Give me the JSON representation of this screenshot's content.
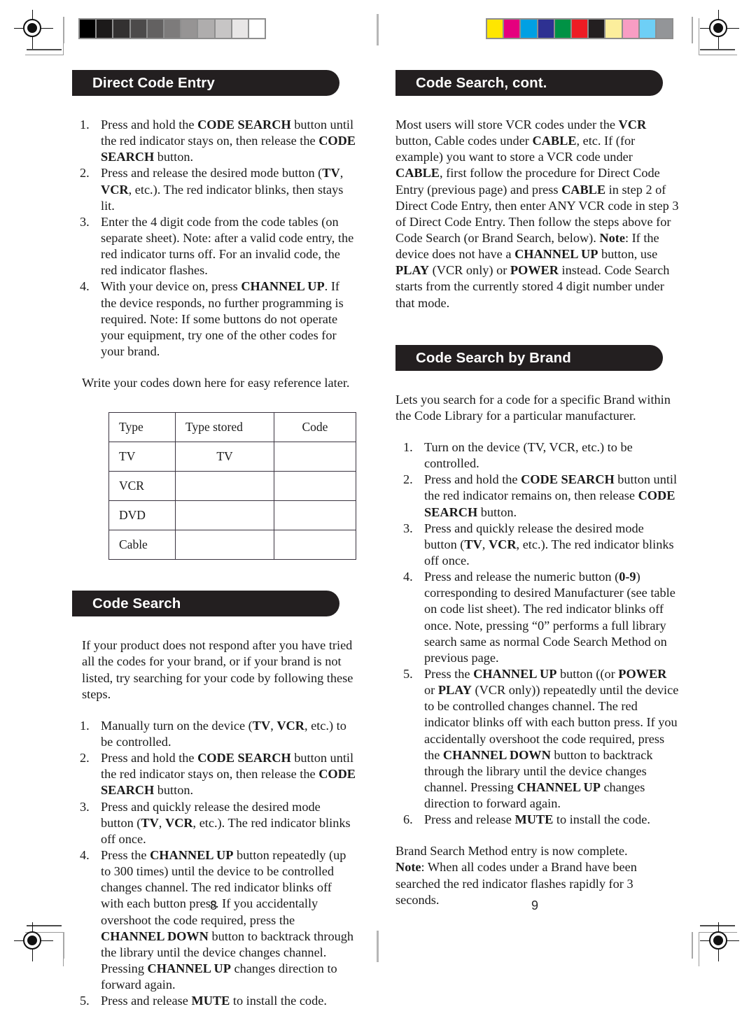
{
  "document": {
    "type": "universal-remote-instruction-manual-spread",
    "left_page_number": "8",
    "right_page_number": "9"
  },
  "print_marks": {
    "grayscale_strip": {
      "name": "grayscale-step-wedge",
      "patches": [
        "#000000",
        "#1c1a1a",
        "#333131",
        "#4c4a4a",
        "#636161",
        "#7d7b7b",
        "#969494",
        "#afadad",
        "#c7c5c5",
        "#e8e6e6",
        "#ffffff"
      ]
    },
    "color_strip": {
      "name": "process-color-bar",
      "patches": [
        "#ffe600",
        "#e5007e",
        "#00a0e3",
        "#2e3192",
        "#009245",
        "#ed1c24",
        "#231f20",
        "#fcee9c",
        "#f89dc3",
        "#6ecff6",
        "#939598"
      ]
    }
  },
  "left_page": {
    "section1": {
      "heading": "Direct Code Entry",
      "steps": [
        {
          "num": "1.",
          "parts": [
            {
              "t": "Press and hold the ",
              "b": false
            },
            {
              "t": "CODE SEARCH",
              "b": true
            },
            {
              "t": " button until the red indicator stays on, then release the ",
              "b": false
            },
            {
              "t": "CODE SEARCH",
              "b": true
            },
            {
              "t": " button.",
              "b": false
            }
          ]
        },
        {
          "num": "2.",
          "parts": [
            {
              "t": "Press and release the desired mode button (",
              "b": false
            },
            {
              "t": "TV",
              "b": true
            },
            {
              "t": ", ",
              "b": false
            },
            {
              "t": "VCR",
              "b": true
            },
            {
              "t": ", etc.). The red indicator blinks, then stays lit.",
              "b": false
            }
          ]
        },
        {
          "num": "3.",
          "parts": [
            {
              "t": "Enter the 4 digit code from the code tables (on separate sheet). Note: after a valid code entry, the red indicator turns off.  For an invalid code, the red indicator flashes.",
              "b": false
            }
          ]
        },
        {
          "num": "4.",
          "parts": [
            {
              "t": "With your device on, press ",
              "b": false
            },
            {
              "t": "CHANNEL UP",
              "b": true
            },
            {
              "t": ". If the device responds, no further programming is required. Note: If some buttons do not operate your equipment, try one of the other codes for your brand.",
              "b": false
            }
          ]
        }
      ],
      "note_line": "Write your codes down here for easy reference later.",
      "table": {
        "headers": [
          "Type",
          "Type stored",
          "Code"
        ],
        "rows": [
          [
            "TV",
            "TV",
            ""
          ],
          [
            "VCR",
            "",
            ""
          ],
          [
            "DVD",
            "",
            ""
          ],
          [
            "Cable",
            "",
            ""
          ]
        ]
      }
    },
    "section2": {
      "heading": "Code Search",
      "intro": "If your product does not respond after you have tried all the codes for your brand, or if your brand is not listed, try searching for your code by following these steps.",
      "steps": [
        {
          "num": "1.",
          "parts": [
            {
              "t": "Manually turn on the device (",
              "b": false
            },
            {
              "t": "TV",
              "b": true
            },
            {
              "t": ", ",
              "b": false
            },
            {
              "t": "VCR",
              "b": true
            },
            {
              "t": ", etc.) to be controlled.",
              "b": false
            }
          ]
        },
        {
          "num": "2.",
          "parts": [
            {
              "t": "Press and hold the ",
              "b": false
            },
            {
              "t": "CODE SEARCH",
              "b": true
            },
            {
              "t": " button until the red indicator stays on, then release the ",
              "b": false
            },
            {
              "t": "CODE SEARCH",
              "b": true
            },
            {
              "t": " button.",
              "b": false
            }
          ]
        },
        {
          "num": "3.",
          "parts": [
            {
              "t": "Press and quickly release the desired mode button (",
              "b": false
            },
            {
              "t": "TV",
              "b": true
            },
            {
              "t": ", ",
              "b": false
            },
            {
              "t": "VCR",
              "b": true
            },
            {
              "t": ", etc.). The red indicator blinks off once.",
              "b": false
            }
          ]
        },
        {
          "num": "4.",
          "parts": [
            {
              "t": "Press the ",
              "b": false
            },
            {
              "t": "CHANNEL UP",
              "b": true
            },
            {
              "t": " button repeatedly (up to 300 times) until the device to be controlled changes channel. The red indicator blinks off with each button press.  If you accidentally overshoot the code required, press the ",
              "b": false
            },
            {
              "t": "CHANNEL DOWN",
              "b": true
            },
            {
              "t": " button to backtrack through the library until the device changes channel. Pressing ",
              "b": false
            },
            {
              "t": "CHANNEL UP",
              "b": true
            },
            {
              "t": " changes direction to forward again.",
              "b": false
            }
          ]
        },
        {
          "num": "5.",
          "parts": [
            {
              "t": "Press and release ",
              "b": false
            },
            {
              "t": "MUTE",
              "b": true
            },
            {
              "t": " to install the code.",
              "b": false
            }
          ]
        }
      ]
    }
  },
  "right_page": {
    "section1": {
      "heading": "Code Search, cont.",
      "body_parts": [
        {
          "t": "Most users will store VCR codes under the ",
          "b": false
        },
        {
          "t": "VCR",
          "b": true
        },
        {
          "t": " button, Cable codes under ",
          "b": false
        },
        {
          "t": "CABLE",
          "b": true
        },
        {
          "t": ", etc. If (for example) you want to store a VCR code under ",
          "b": false
        },
        {
          "t": "CABLE",
          "b": true
        },
        {
          "t": ", first follow the procedure for Direct Code Entry (previous page) and press ",
          "b": false
        },
        {
          "t": "CABLE",
          "b": true
        },
        {
          "t": " in step 2 of Direct Code Entry, then enter ANY VCR code in step 3 of Direct Code Entry. Then follow the steps above for Code Search (or Brand Search, below). ",
          "b": false
        },
        {
          "t": "Note",
          "b": true
        },
        {
          "t": ":  If the device does not have a ",
          "b": false
        },
        {
          "t": "CHANNEL UP",
          "b": true
        },
        {
          "t": " button, use ",
          "b": false
        },
        {
          "t": "PLAY",
          "b": true
        },
        {
          "t": " (VCR only) or ",
          "b": false
        },
        {
          "t": "POWER",
          "b": true
        },
        {
          "t": " instead. Code Search starts from the currently stored 4 digit number under that mode.",
          "b": false
        }
      ]
    },
    "section2": {
      "heading": "Code Search by Brand",
      "intro": "Lets you search for a code for a specific Brand within the Code Library for a particular manufacturer.",
      "steps": [
        {
          "num": "1.",
          "parts": [
            {
              "t": "Turn on the device (TV, VCR, etc.) to be controlled.",
              "b": false
            }
          ]
        },
        {
          "num": "2.",
          "parts": [
            {
              "t": "Press and hold the ",
              "b": false
            },
            {
              "t": "CODE SEARCH",
              "b": true
            },
            {
              "t": " button until the red indicator remains on, then release ",
              "b": false
            },
            {
              "t": "CODE SEARCH",
              "b": true
            },
            {
              "t": " button.",
              "b": false
            }
          ]
        },
        {
          "num": "3.",
          "parts": [
            {
              "t": "Press and quickly release the desired mode button (",
              "b": false
            },
            {
              "t": "TV",
              "b": true
            },
            {
              "t": ", ",
              "b": false
            },
            {
              "t": "VCR",
              "b": true
            },
            {
              "t": ", etc.). The red indicator blinks off once.",
              "b": false
            }
          ]
        },
        {
          "num": "4.",
          "parts": [
            {
              "t": "Press and release the numeric button (",
              "b": false
            },
            {
              "t": "0-9",
              "b": true
            },
            {
              "t": ") corresponding to desired Manufacturer (see table on code list sheet).  The red indicator blinks off once. Note, pressing “0” performs a full library search same as normal Code Search Method on previous page.",
              "b": false
            }
          ]
        },
        {
          "num": "5.",
          "parts": [
            {
              "t": "Press the ",
              "b": false
            },
            {
              "t": "CHANNEL UP",
              "b": true
            },
            {
              "t": " button ((or ",
              "b": false
            },
            {
              "t": "POWER",
              "b": true
            },
            {
              "t": " or ",
              "b": false
            },
            {
              "t": "PLAY",
              "b": true
            },
            {
              "t": " (VCR only)) repeatedly until the device to be controlled changes channel. The red indicator blinks off with each button press. If you accidentally overshoot the code required, press the ",
              "b": false
            },
            {
              "t": "CHANNEL DOWN",
              "b": true
            },
            {
              "t": " button to backtrack through the library until the device changes channel. Pressing ",
              "b": false
            },
            {
              "t": "CHANNEL UP",
              "b": true
            },
            {
              "t": " changes direction to forward again.",
              "b": false
            }
          ]
        },
        {
          "num": "6.",
          "parts": [
            {
              "t": "Press and release ",
              "b": false
            },
            {
              "t": "MUTE",
              "b": true
            },
            {
              "t": " to install the code.",
              "b": false
            }
          ]
        }
      ],
      "closing_line": "Brand Search Method entry is now complete.",
      "closing_note_parts": [
        {
          "t": "Note",
          "b": true
        },
        {
          "t": ": When all codes under a Brand have been searched the red indicator flashes rapidly for 3 seconds.",
          "b": false
        }
      ]
    }
  }
}
